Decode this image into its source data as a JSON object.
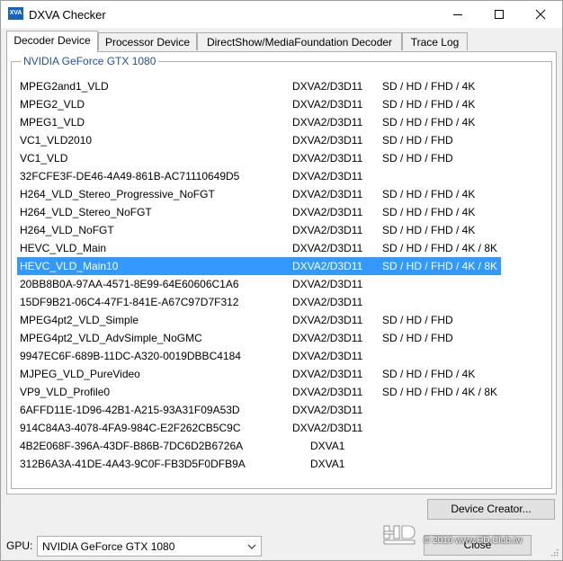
{
  "window": {
    "title": "DXVA Checker",
    "app_icon_text": "XVA"
  },
  "tabs": [
    {
      "label": "Decoder Device",
      "active": true
    },
    {
      "label": "Processor Device",
      "active": false
    },
    {
      "label": "DirectShow/MediaFoundation Decoder",
      "active": false
    },
    {
      "label": "Trace Log",
      "active": false
    }
  ],
  "group": {
    "label": "NVIDIA GeForce GTX 1080"
  },
  "decoders": [
    {
      "name": "MPEG2and1_VLD",
      "api": "DXVA2/D3D11",
      "res": "SD / HD / FHD / 4K"
    },
    {
      "name": "MPEG2_VLD",
      "api": "DXVA2/D3D11",
      "res": "SD / HD / FHD / 4K"
    },
    {
      "name": "MPEG1_VLD",
      "api": "DXVA2/D3D11",
      "res": "SD / HD / FHD / 4K"
    },
    {
      "name": "VC1_VLD2010",
      "api": "DXVA2/D3D11",
      "res": "SD / HD / FHD"
    },
    {
      "name": "VC1_VLD",
      "api": "DXVA2/D3D11",
      "res": "SD / HD / FHD"
    },
    {
      "name": "32FCFE3F-DE46-4A49-861B-AC71110649D5",
      "api": "DXVA2/D3D11",
      "res": ""
    },
    {
      "name": "H264_VLD_Stereo_Progressive_NoFGT",
      "api": "DXVA2/D3D11",
      "res": "SD / HD / FHD / 4K"
    },
    {
      "name": "H264_VLD_Stereo_NoFGT",
      "api": "DXVA2/D3D11",
      "res": "SD / HD / FHD / 4K"
    },
    {
      "name": "H264_VLD_NoFGT",
      "api": "DXVA2/D3D11",
      "res": "SD / HD / FHD / 4K"
    },
    {
      "name": "HEVC_VLD_Main",
      "api": "DXVA2/D3D11",
      "res": "SD / HD / FHD / 4K / 8K"
    },
    {
      "name": "HEVC_VLD_Main10",
      "api": "DXVA2/D3D11",
      "res": "SD / HD / FHD / 4K / 8K",
      "selected": true
    },
    {
      "name": "20BB8B0A-97AA-4571-8E99-64E60606C1A6",
      "api": "DXVA2/D3D11",
      "res": ""
    },
    {
      "name": "15DF9B21-06C4-47F1-841E-A67C97D7F312",
      "api": "DXVA2/D3D11",
      "res": ""
    },
    {
      "name": "MPEG4pt2_VLD_Simple",
      "api": "DXVA2/D3D11",
      "res": "SD / HD / FHD"
    },
    {
      "name": "MPEG4pt2_VLD_AdvSimple_NoGMC",
      "api": "DXVA2/D3D11",
      "res": "SD / HD / FHD"
    },
    {
      "name": "9947EC6F-689B-11DC-A320-0019DBBC4184",
      "api": "DXVA2/D3D11",
      "res": ""
    },
    {
      "name": "MJPEG_VLD_PureVideo",
      "api": "DXVA2/D3D11",
      "res": "SD / HD / FHD / 4K"
    },
    {
      "name": "VP9_VLD_Profile0",
      "api": "DXVA2/D3D11",
      "res": "SD / HD / FHD / 4K / 8K"
    },
    {
      "name": "6AFFD11E-1D96-42B1-A215-93A31F09A53D",
      "api": "DXVA2/D3D11",
      "res": ""
    },
    {
      "name": "914C84A3-4078-4FA9-984C-E2F262CB5C9C",
      "api": "DXVA2/D3D11",
      "res": ""
    },
    {
      "name": "4B2E068F-396A-43DF-B86B-7DC6D2B6726A",
      "api": "DXVA1",
      "res": ""
    },
    {
      "name": "312B6A3A-41DE-4A43-9C0F-FB3D5F0DFB9A",
      "api": "DXVA1",
      "res": ""
    }
  ],
  "buttons": {
    "device_creator": "Device Creator...",
    "close": "Close"
  },
  "gpu": {
    "label": "GPU:",
    "selected": "NVIDIA GeForce GTX 1080"
  },
  "watermark": {
    "text": "© 2016 www.HD.Club.tw"
  },
  "colors": {
    "selection": "#3399ff",
    "group_label": "#1f4e9e",
    "app_icon": "#1565c0"
  }
}
